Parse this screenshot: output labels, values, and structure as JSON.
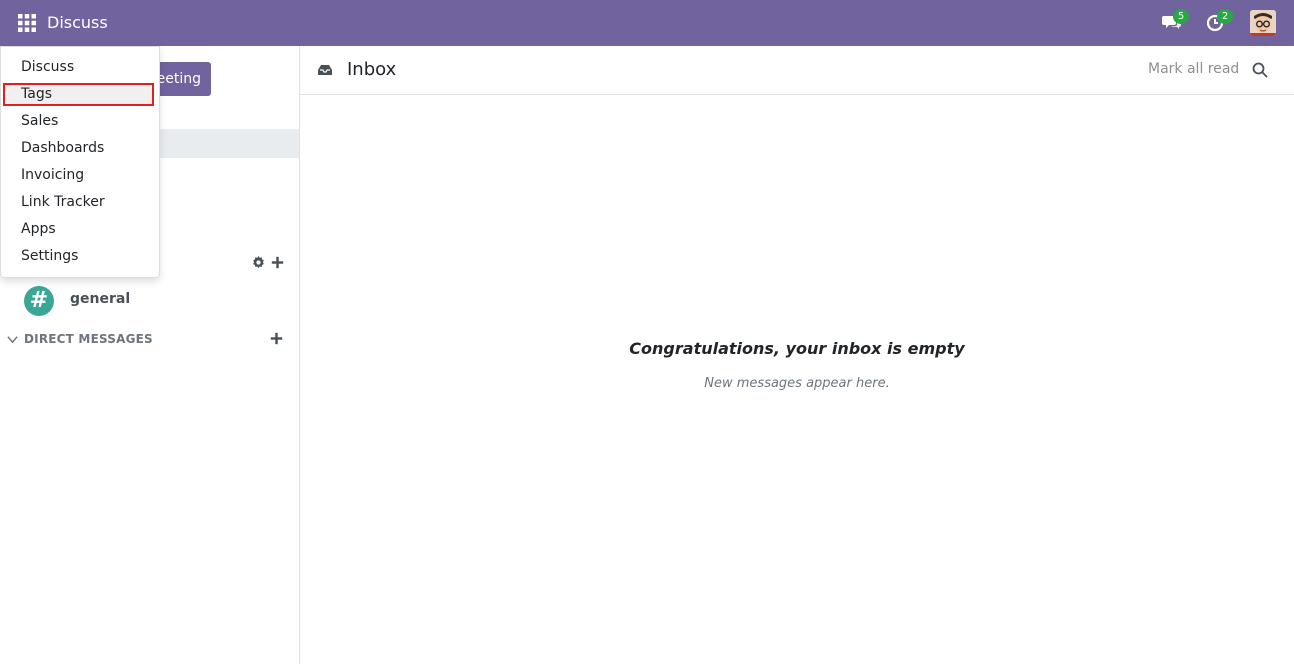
{
  "navbar": {
    "app_title": "Discuss",
    "messages_count": "5",
    "activities_count": "2",
    "bg_color": "#71639e"
  },
  "sidebar": {
    "meeting_button_label": "eeting",
    "channel_name": "general",
    "direct_messages_title": "DIRECT MESSAGES"
  },
  "dropdown": {
    "items": [
      "Discuss",
      "Tags",
      "Sales",
      "Dashboards",
      "Invoicing",
      "Link Tracker",
      "Apps",
      "Settings"
    ],
    "highlighted_item": "Tags"
  },
  "main": {
    "title": "Inbox",
    "mark_all_read": "Mark all read",
    "empty_title": "Congratulations, your inbox is empty",
    "empty_subtitle": "New messages appear here."
  },
  "colors": {
    "brand": "#71639e",
    "badge": "#28a745",
    "channel_avatar": "#3aa796",
    "highlight_border": "#e02020"
  }
}
